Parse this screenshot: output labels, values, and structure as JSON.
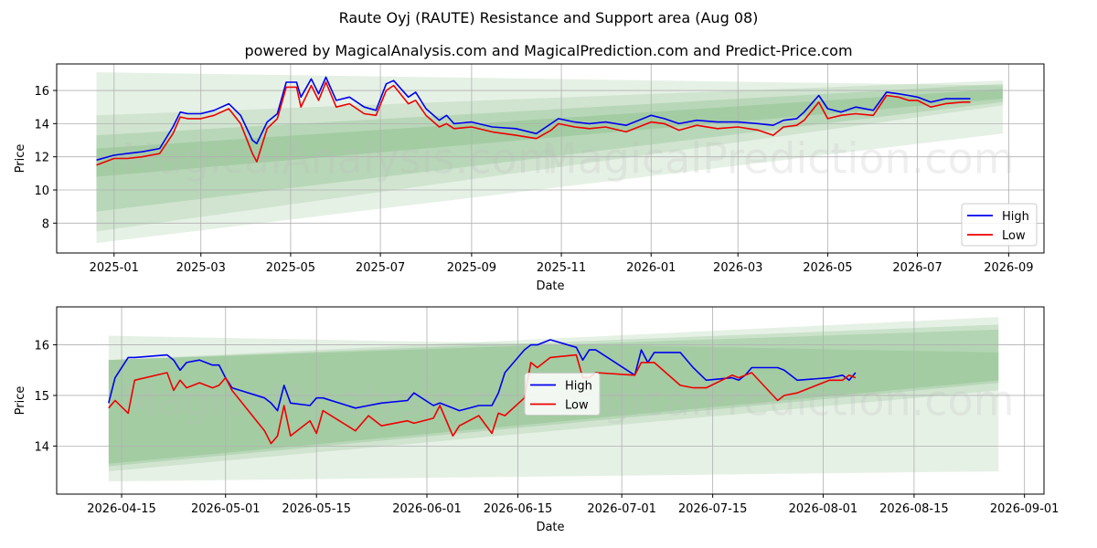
{
  "header": {
    "title": "Raute Oyj (RAUTE) Resistance and Support area (Aug 08)",
    "subtitle": "powered by MagicalAnalysis.com and MagicalPrediction.com and Predict-Price.com"
  },
  "watermarks": [
    "MagicalAnalysis.com",
    "MagicalPrediction.com"
  ],
  "colors": {
    "high": "#0000ee",
    "low": "#ee0000",
    "band": "#2e8b2e"
  },
  "chart_data": [
    {
      "type": "line",
      "xlabel": "Date",
      "ylabel": "Price",
      "x_ticks": [
        "2025-01",
        "2025-03",
        "2025-05",
        "2025-07",
        "2025-09",
        "2025-11",
        "2026-01",
        "2026-03",
        "2026-05",
        "2026-07",
        "2026-09"
      ],
      "y_ticks": [
        8,
        10,
        12,
        14,
        16
      ],
      "xlim": [
        "2024-11-23",
        "2026-09-25"
      ],
      "ylim": [
        6.2,
        17.6
      ],
      "grid": true,
      "legend": {
        "position": "bottom-right",
        "entries": [
          "High",
          "Low"
        ]
      },
      "bands": [
        {
          "x": [
            "2024-12-20",
            "2026-08-28"
          ],
          "upper": [
            17.1,
            16.3
          ],
          "lower": [
            6.8,
            13.4
          ],
          "alpha": 0.12
        },
        {
          "x": [
            "2024-12-20",
            "2026-08-28"
          ],
          "upper": [
            14.5,
            16.6
          ],
          "lower": [
            7.5,
            15.1
          ],
          "alpha": 0.12
        },
        {
          "x": [
            "2024-12-20",
            "2026-08-28"
          ],
          "upper": [
            13.3,
            16.4
          ],
          "lower": [
            8.7,
            15.3
          ],
          "alpha": 0.15
        },
        {
          "x": [
            "2024-12-20",
            "2026-08-28"
          ],
          "upper": [
            12.5,
            16.1
          ],
          "lower": [
            10.8,
            15.5
          ],
          "alpha": 0.15
        }
      ],
      "series": [
        {
          "name": "High",
          "x": [
            "2024-12-20",
            "2025-01-01",
            "2025-01-10",
            "2025-01-20",
            "2025-02-01",
            "2025-02-10",
            "2025-02-15",
            "2025-02-20",
            "2025-03-01",
            "2025-03-10",
            "2025-03-20",
            "2025-03-28",
            "2025-04-05",
            "2025-04-08",
            "2025-04-15",
            "2025-04-22",
            "2025-04-28",
            "2025-05-05",
            "2025-05-08",
            "2025-05-15",
            "2025-05-20",
            "2025-05-25",
            "2025-06-01",
            "2025-06-10",
            "2025-06-20",
            "2025-06-28",
            "2025-07-05",
            "2025-07-10",
            "2025-07-20",
            "2025-07-25",
            "2025-08-01",
            "2025-08-10",
            "2025-08-15",
            "2025-08-20",
            "2025-09-01",
            "2025-09-15",
            "2025-10-01",
            "2025-10-15",
            "2025-10-25",
            "2025-10-30",
            "2025-11-10",
            "2025-11-20",
            "2025-12-01",
            "2025-12-15",
            "2026-01-01",
            "2026-01-10",
            "2026-01-20",
            "2026-02-01",
            "2026-02-15",
            "2026-03-01",
            "2026-03-15",
            "2026-03-25",
            "2026-04-01",
            "2026-04-10",
            "2026-04-15",
            "2026-04-25",
            "2026-05-01",
            "2026-05-10",
            "2026-05-20",
            "2026-06-01",
            "2026-06-10",
            "2026-06-18",
            "2026-06-25",
            "2026-07-01",
            "2026-07-10",
            "2026-07-20",
            "2026-08-01",
            "2026-08-06"
          ],
          "values": [
            11.8,
            12.1,
            12.2,
            12.3,
            12.5,
            13.8,
            14.7,
            14.6,
            14.6,
            14.8,
            15.2,
            14.5,
            13.0,
            12.8,
            14.1,
            14.6,
            16.5,
            16.5,
            15.6,
            16.7,
            15.8,
            16.8,
            15.4,
            15.6,
            15.0,
            14.8,
            16.4,
            16.6,
            15.6,
            15.9,
            14.9,
            14.2,
            14.5,
            14.0,
            14.1,
            13.8,
            13.7,
            13.4,
            14.0,
            14.3,
            14.1,
            14.0,
            14.1,
            13.9,
            14.5,
            14.3,
            14.0,
            14.2,
            14.1,
            14.1,
            14.0,
            13.9,
            14.2,
            14.3,
            14.7,
            15.7,
            14.9,
            14.7,
            15.0,
            14.8,
            15.9,
            15.8,
            15.7,
            15.6,
            15.3,
            15.5,
            15.5,
            15.5
          ]
        },
        {
          "name": "Low",
          "x": [
            "2024-12-20",
            "2025-01-01",
            "2025-01-10",
            "2025-01-20",
            "2025-02-01",
            "2025-02-10",
            "2025-02-15",
            "2025-02-20",
            "2025-03-01",
            "2025-03-10",
            "2025-03-20",
            "2025-03-28",
            "2025-04-05",
            "2025-04-08",
            "2025-04-15",
            "2025-04-22",
            "2025-04-28",
            "2025-05-05",
            "2025-05-08",
            "2025-05-15",
            "2025-05-20",
            "2025-05-25",
            "2025-06-01",
            "2025-06-10",
            "2025-06-20",
            "2025-06-28",
            "2025-07-05",
            "2025-07-10",
            "2025-07-20",
            "2025-07-25",
            "2025-08-01",
            "2025-08-10",
            "2025-08-15",
            "2025-08-20",
            "2025-09-01",
            "2025-09-15",
            "2025-10-01",
            "2025-10-15",
            "2025-10-25",
            "2025-10-30",
            "2025-11-10",
            "2025-11-20",
            "2025-12-01",
            "2025-12-15",
            "2026-01-01",
            "2026-01-10",
            "2026-01-20",
            "2026-02-01",
            "2026-02-15",
            "2026-03-01",
            "2026-03-15",
            "2026-03-25",
            "2026-04-01",
            "2026-04-10",
            "2026-04-15",
            "2026-04-25",
            "2026-05-01",
            "2026-05-10",
            "2026-05-20",
            "2026-06-01",
            "2026-06-10",
            "2026-06-18",
            "2026-06-25",
            "2026-07-01",
            "2026-07-10",
            "2026-07-20",
            "2026-08-01",
            "2026-08-06"
          ],
          "values": [
            11.5,
            11.9,
            11.9,
            12.0,
            12.2,
            13.4,
            14.4,
            14.3,
            14.3,
            14.5,
            14.9,
            14.0,
            12.2,
            11.7,
            13.7,
            14.3,
            16.2,
            16.2,
            15.0,
            16.3,
            15.4,
            16.5,
            15.0,
            15.2,
            14.6,
            14.5,
            16.0,
            16.3,
            15.2,
            15.4,
            14.5,
            13.8,
            14.0,
            13.7,
            13.8,
            13.5,
            13.3,
            13.1,
            13.6,
            14.0,
            13.8,
            13.7,
            13.8,
            13.5,
            14.1,
            14.0,
            13.6,
            13.9,
            13.7,
            13.8,
            13.6,
            13.3,
            13.8,
            13.9,
            14.2,
            15.3,
            14.3,
            14.5,
            14.6,
            14.5,
            15.7,
            15.6,
            15.4,
            15.4,
            15.0,
            15.2,
            15.3,
            15.3
          ]
        }
      ]
    },
    {
      "type": "line",
      "xlabel": "Date",
      "ylabel": "Price",
      "x_ticks": [
        "2026-04-15",
        "2026-05-01",
        "2026-05-15",
        "2026-06-01",
        "2026-06-15",
        "2026-07-01",
        "2026-07-15",
        "2026-08-01",
        "2026-08-15",
        "2026-09-01"
      ],
      "y_ticks": [
        14,
        15,
        16
      ],
      "xlim": [
        "2026-04-05",
        "2026-09-04"
      ],
      "ylim": [
        13.05,
        16.75
      ],
      "grid": true,
      "legend": {
        "position": "center",
        "entries": [
          "High",
          "Low"
        ]
      },
      "bands": [
        {
          "x": [
            "2026-04-13",
            "2026-08-28"
          ],
          "upper": [
            16.18,
            15.85
          ],
          "lower": [
            13.3,
            13.5
          ],
          "alpha": 0.12
        },
        {
          "x": [
            "2026-04-13",
            "2026-08-28"
          ],
          "upper": [
            15.7,
            16.55
          ],
          "lower": [
            13.5,
            15.1
          ],
          "alpha": 0.12
        },
        {
          "x": [
            "2026-04-13",
            "2026-08-28"
          ],
          "upper": [
            15.7,
            16.4
          ],
          "lower": [
            13.6,
            15.25
          ],
          "alpha": 0.15
        },
        {
          "x": [
            "2026-04-13",
            "2026-08-28"
          ],
          "upper": [
            15.7,
            16.3
          ],
          "lower": [
            13.65,
            15.3
          ],
          "alpha": 0.15
        }
      ],
      "series": [
        {
          "name": "High",
          "x": [
            "2026-04-13",
            "2026-04-14",
            "2026-04-16",
            "2026-04-17",
            "2026-04-22",
            "2026-04-23",
            "2026-04-24",
            "2026-04-25",
            "2026-04-27",
            "2026-04-29",
            "2026-04-30",
            "2026-05-01",
            "2026-05-02",
            "2026-05-07",
            "2026-05-08",
            "2026-05-09",
            "2026-05-10",
            "2026-05-11",
            "2026-05-14",
            "2026-05-15",
            "2026-05-16",
            "2026-05-21",
            "2026-05-23",
            "2026-05-25",
            "2026-05-29",
            "2026-05-30",
            "2026-06-02",
            "2026-06-03",
            "2026-06-05",
            "2026-06-06",
            "2026-06-09",
            "2026-06-11",
            "2026-06-12",
            "2026-06-13",
            "2026-06-16",
            "2026-06-17",
            "2026-06-18",
            "2026-06-20",
            "2026-06-24",
            "2026-06-25",
            "2026-06-26",
            "2026-06-27",
            "2026-07-03",
            "2026-07-04",
            "2026-07-05",
            "2026-07-06",
            "2026-07-10",
            "2026-07-12",
            "2026-07-14",
            "2026-07-18",
            "2026-07-19",
            "2026-07-20",
            "2026-07-21",
            "2026-07-25",
            "2026-07-26",
            "2026-07-28",
            "2026-08-02",
            "2026-08-04",
            "2026-08-05",
            "2026-08-06"
          ],
          "values": [
            14.85,
            15.35,
            15.75,
            15.75,
            15.8,
            15.7,
            15.5,
            15.65,
            15.7,
            15.6,
            15.6,
            15.35,
            15.15,
            14.95,
            14.85,
            14.7,
            15.2,
            14.85,
            14.8,
            14.95,
            14.95,
            14.75,
            14.8,
            14.85,
            14.9,
            15.05,
            14.8,
            14.85,
            14.75,
            14.7,
            14.8,
            14.8,
            15.05,
            15.45,
            15.9,
            16.0,
            16.0,
            16.1,
            15.95,
            15.7,
            15.9,
            15.9,
            15.4,
            15.9,
            15.65,
            15.85,
            15.85,
            15.55,
            15.3,
            15.35,
            15.3,
            15.4,
            15.55,
            15.55,
            15.5,
            15.3,
            15.35,
            15.4,
            15.3,
            15.45
          ]
        },
        {
          "name": "Low",
          "x": [
            "2026-04-13",
            "2026-04-14",
            "2026-04-16",
            "2026-04-17",
            "2026-04-22",
            "2026-04-23",
            "2026-04-24",
            "2026-04-25",
            "2026-04-27",
            "2026-04-29",
            "2026-04-30",
            "2026-05-01",
            "2026-05-02",
            "2026-05-07",
            "2026-05-08",
            "2026-05-09",
            "2026-05-10",
            "2026-05-11",
            "2026-05-14",
            "2026-05-15",
            "2026-05-16",
            "2026-05-21",
            "2026-05-23",
            "2026-05-25",
            "2026-05-29",
            "2026-05-30",
            "2026-06-02",
            "2026-06-03",
            "2026-06-05",
            "2026-06-06",
            "2026-06-09",
            "2026-06-11",
            "2026-06-12",
            "2026-06-13",
            "2026-06-16",
            "2026-06-17",
            "2026-06-18",
            "2026-06-20",
            "2026-06-24",
            "2026-06-25",
            "2026-06-26",
            "2026-06-27",
            "2026-07-03",
            "2026-07-04",
            "2026-07-05",
            "2026-07-06",
            "2026-07-10",
            "2026-07-12",
            "2026-07-14",
            "2026-07-18",
            "2026-07-19",
            "2026-07-20",
            "2026-07-21",
            "2026-07-25",
            "2026-07-26",
            "2026-07-28",
            "2026-08-02",
            "2026-08-04",
            "2026-08-05",
            "2026-08-06"
          ],
          "values": [
            14.75,
            14.9,
            14.65,
            15.3,
            15.45,
            15.1,
            15.3,
            15.15,
            15.25,
            15.15,
            15.2,
            15.35,
            15.1,
            14.3,
            14.05,
            14.2,
            14.8,
            14.2,
            14.5,
            14.25,
            14.7,
            14.3,
            14.6,
            14.4,
            14.5,
            14.45,
            14.55,
            14.8,
            14.2,
            14.4,
            14.6,
            14.25,
            14.65,
            14.6,
            14.95,
            15.65,
            15.55,
            15.75,
            15.8,
            15.35,
            15.35,
            15.45,
            15.4,
            15.65,
            15.65,
            15.65,
            15.2,
            15.15,
            15.15,
            15.4,
            15.35,
            15.4,
            15.45,
            14.9,
            15.0,
            15.05,
            15.3,
            15.3,
            15.4,
            15.35
          ]
        }
      ]
    }
  ]
}
